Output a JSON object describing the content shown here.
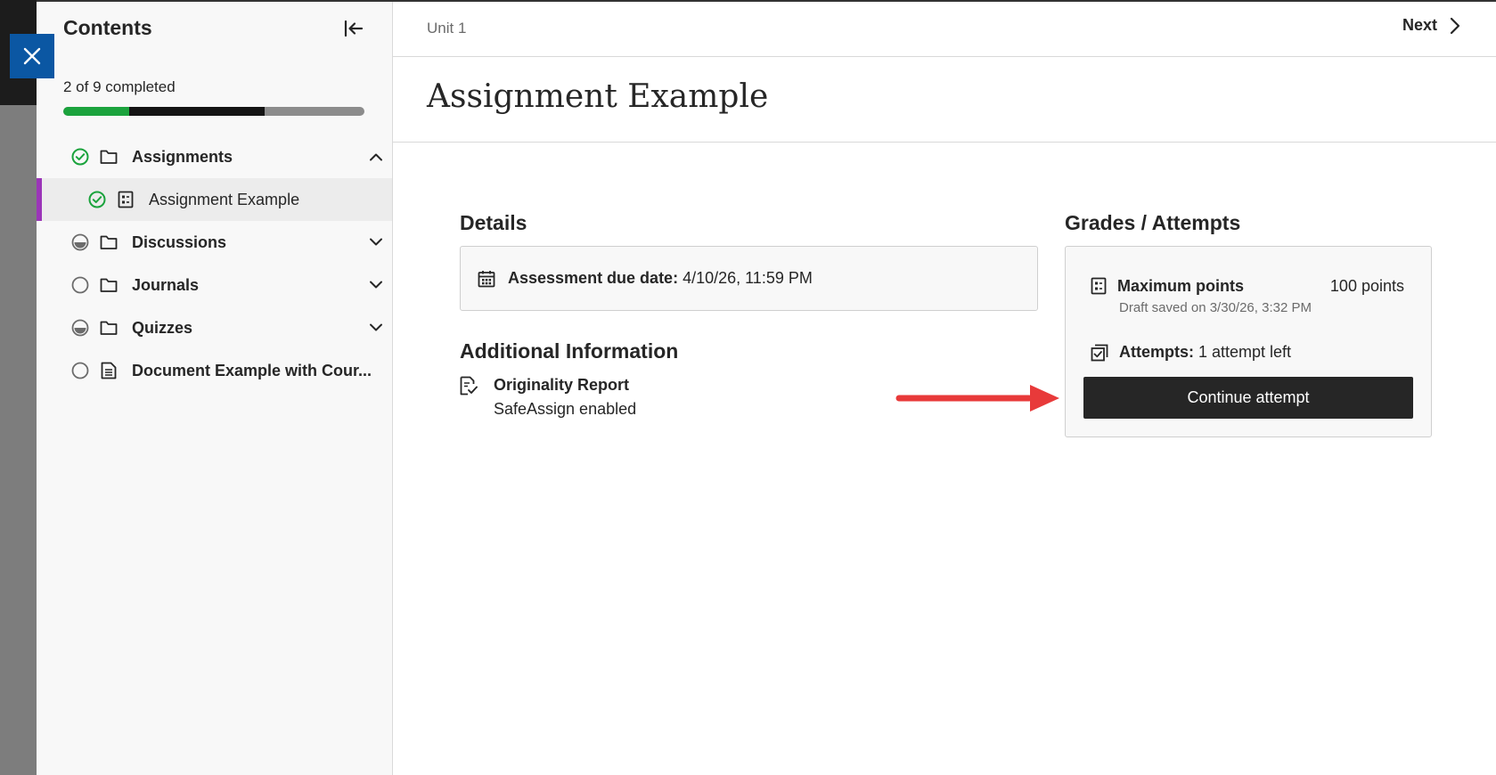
{
  "sidebar": {
    "title": "Contents",
    "progress_text": "2 of 9 completed",
    "progress": {
      "completed_fraction": 0.22,
      "in_progress_fraction": 0.45
    },
    "items": [
      {
        "label": "Assignments",
        "status": "completed",
        "icon": "folder-icon",
        "expanded": true
      },
      {
        "label": "Assignment Example",
        "status": "completed",
        "icon": "assignment-icon",
        "selected": true
      },
      {
        "label": "Discussions",
        "status": "in-progress",
        "icon": "folder-icon",
        "expanded": false
      },
      {
        "label": "Journals",
        "status": "not-started",
        "icon": "folder-icon",
        "expanded": false
      },
      {
        "label": "Quizzes",
        "status": "in-progress",
        "icon": "folder-icon",
        "expanded": false
      },
      {
        "label": "Document Example with Cour...",
        "status": "not-started",
        "icon": "document-icon"
      }
    ]
  },
  "header": {
    "breadcrumb": "Unit 1",
    "next_label": "Next"
  },
  "page": {
    "title": "Assignment Example"
  },
  "details": {
    "title": "Details",
    "due_label": "Assessment due date:",
    "due_value": " 4/10/26, 11:59 PM"
  },
  "additional": {
    "title": "Additional Information",
    "originality_title": "Originality Report",
    "originality_sub": "SafeAssign enabled"
  },
  "grades": {
    "title": "Grades / Attempts",
    "max_points_label": "Maximum points",
    "max_points_value": "100 points",
    "draft_saved": "Draft saved on 3/30/26, 3:32 PM",
    "attempts_label": "Attempts:",
    "attempts_value": " 1 attempt left",
    "continue_label": "Continue attempt"
  },
  "colors": {
    "accent_selected": "#9b35b8",
    "completed": "#1ba33d",
    "close_button": "#0b57a3",
    "arrow": "#e83a3a"
  }
}
